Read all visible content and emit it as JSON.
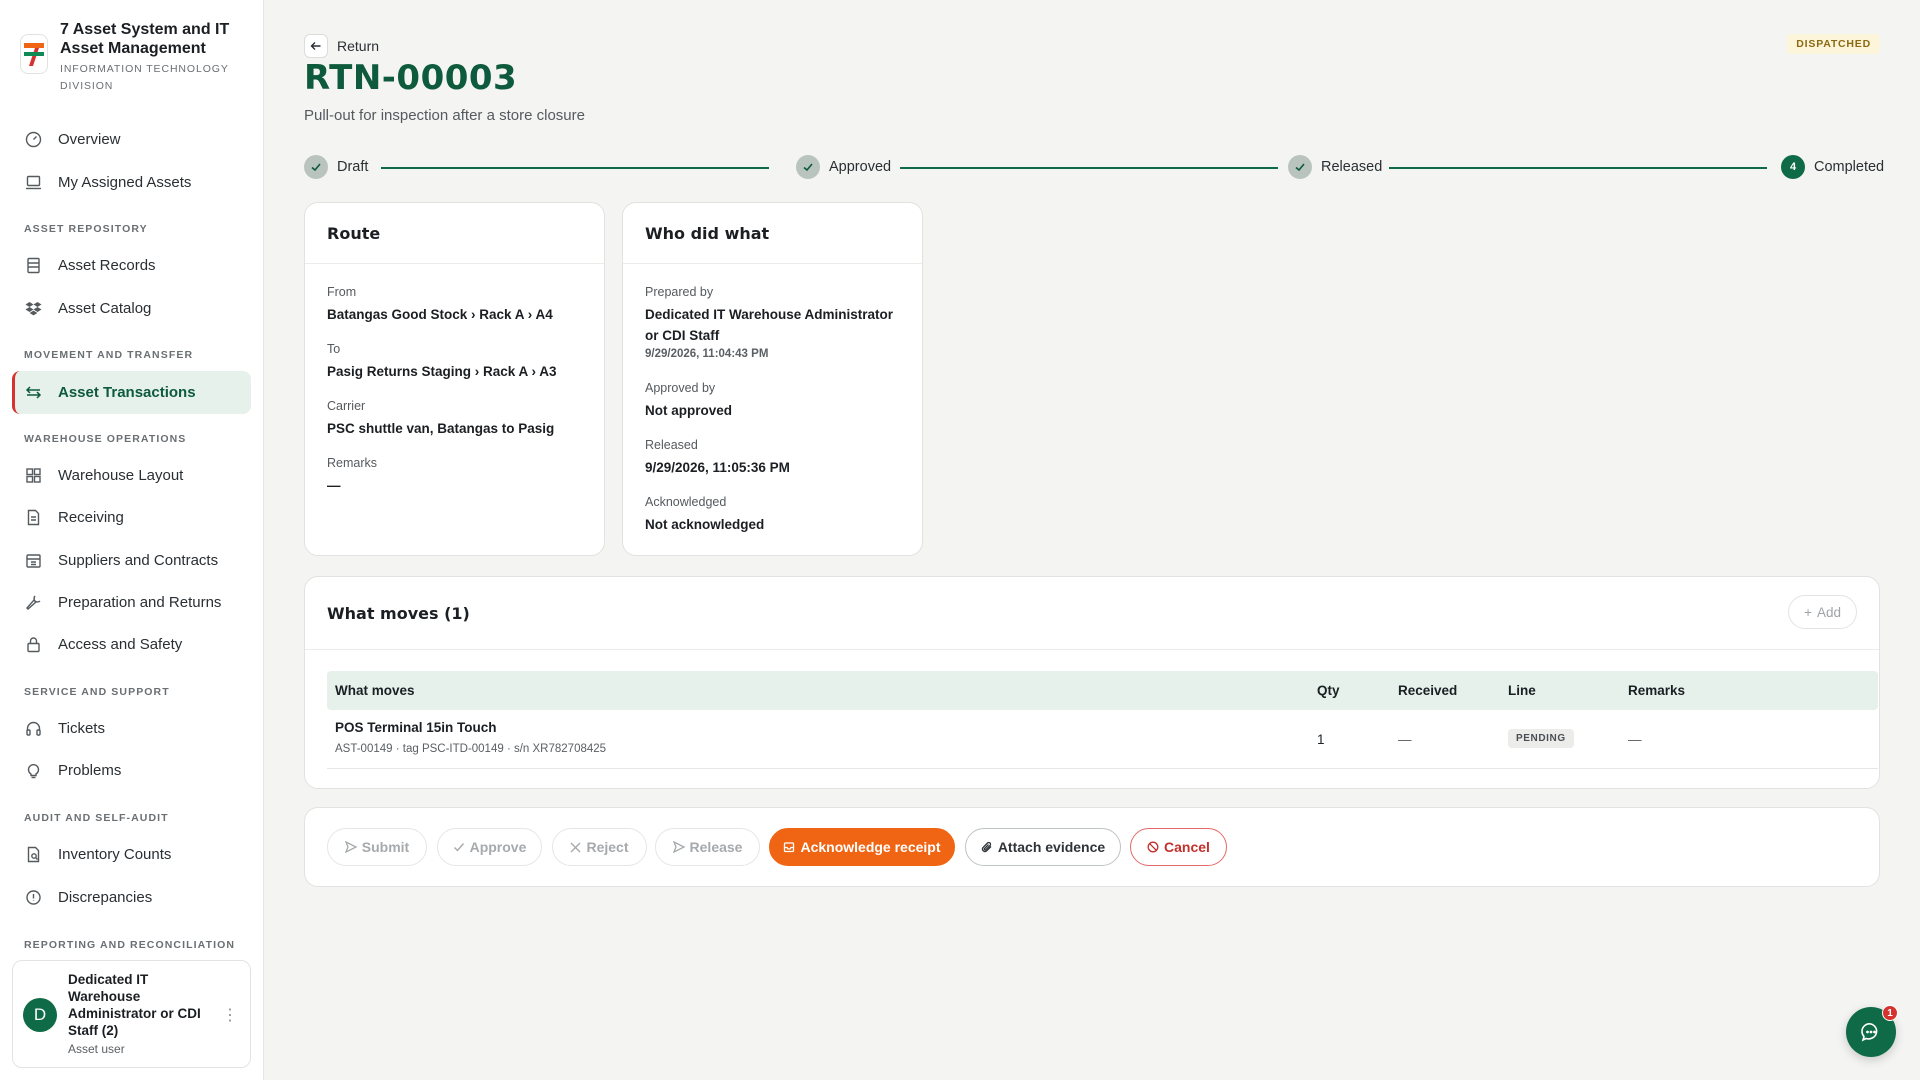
{
  "app": {
    "title": "7 Asset System and IT Asset Management",
    "subtitle": "Information Technology Division",
    "logo_text": "7-ELEVEN"
  },
  "sidebar": {
    "top_items": [
      {
        "label": "Overview",
        "icon": "gauge-icon"
      },
      {
        "label": "My Assigned Assets",
        "icon": "laptop-icon"
      }
    ],
    "sections": [
      {
        "label": "Asset Repository",
        "items": [
          {
            "label": "Asset Records",
            "icon": "records-icon"
          },
          {
            "label": "Asset Catalog",
            "icon": "dropbox-icon"
          }
        ]
      },
      {
        "label": "Movement and Transfer",
        "items": [
          {
            "label": "Asset Transactions",
            "icon": "arrows-icon",
            "active": true
          }
        ]
      },
      {
        "label": "Warehouse Operations",
        "items": [
          {
            "label": "Warehouse Layout",
            "icon": "grid-icon"
          },
          {
            "label": "Receiving",
            "icon": "document-icon"
          },
          {
            "label": "Suppliers and Contracts",
            "icon": "supplier-icon"
          },
          {
            "label": "Preparation and Returns",
            "icon": "wrench-icon"
          },
          {
            "label": "Access and Safety",
            "icon": "lock-icon"
          }
        ]
      },
      {
        "label": "Service and Support",
        "items": [
          {
            "label": "Tickets",
            "icon": "headset-icon"
          },
          {
            "label": "Problems",
            "icon": "lightbulb-icon"
          }
        ]
      },
      {
        "label": "Audit and Self-Audit",
        "items": [
          {
            "label": "Inventory Counts",
            "icon": "count-icon"
          },
          {
            "label": "Discrepancies",
            "icon": "alert-icon"
          }
        ]
      },
      {
        "label": "Reporting and Reconciliation",
        "items": []
      }
    ],
    "user": {
      "initial": "D",
      "name": "Dedicated IT Warehouse Administrator or CDI Staff (2)",
      "role": "Asset user"
    }
  },
  "header": {
    "back_label": "Return",
    "title": "RTN-00003",
    "subtitle": "Pull-out for inspection after a store closure",
    "status": "DISPATCHED"
  },
  "stepper": [
    {
      "label": "Draft",
      "state": "done"
    },
    {
      "label": "Approved",
      "state": "done"
    },
    {
      "label": "Released",
      "state": "done"
    },
    {
      "label": "Completed",
      "state": "current",
      "number": "4"
    }
  ],
  "route": {
    "title": "Route",
    "from_label": "From",
    "from": "Batangas Good Stock › Rack A › A4",
    "to_label": "To",
    "to": "Pasig Returns Staging › Rack A › A3",
    "carrier_label": "Carrier",
    "carrier": "PSC shuttle van, Batangas to Pasig",
    "remarks_label": "Remarks",
    "remarks": "—"
  },
  "who": {
    "title": "Who did what",
    "prepared_label": "Prepared by",
    "prepared_by": "Dedicated IT Warehouse Administrator or CDI Staff",
    "prepared_at": "9/29/2026, 11:04:43 PM",
    "approved_label": "Approved by",
    "approved_by": "Not approved",
    "released_label": "Released",
    "released_at": "9/29/2026, 11:05:36 PM",
    "ack_label": "Acknowledged",
    "ack": "Not acknowledged"
  },
  "moves": {
    "title": "What moves (1)",
    "add_label": "Add",
    "columns": [
      "What moves",
      "Qty",
      "Received",
      "Line",
      "Remarks"
    ],
    "rows": [
      {
        "name": "POS Terminal 15in Touch",
        "meta": "AST-00149 · tag PSC-ITD-00149 · s/n XR782708425",
        "qty": "1",
        "received": "—",
        "line": "PENDING",
        "remarks": "—"
      }
    ]
  },
  "actions": {
    "submit": "Submit",
    "approve": "Approve",
    "reject": "Reject",
    "release": "Release",
    "acknowledge": "Acknowledge receipt",
    "attach": "Attach evidence",
    "cancel": "Cancel"
  },
  "chat": {
    "badge": "1"
  },
  "colors": {
    "brand": "#0f6b47",
    "accent": "#f06513",
    "danger": "#c4302b",
    "active_bg": "#e6f1ec"
  }
}
